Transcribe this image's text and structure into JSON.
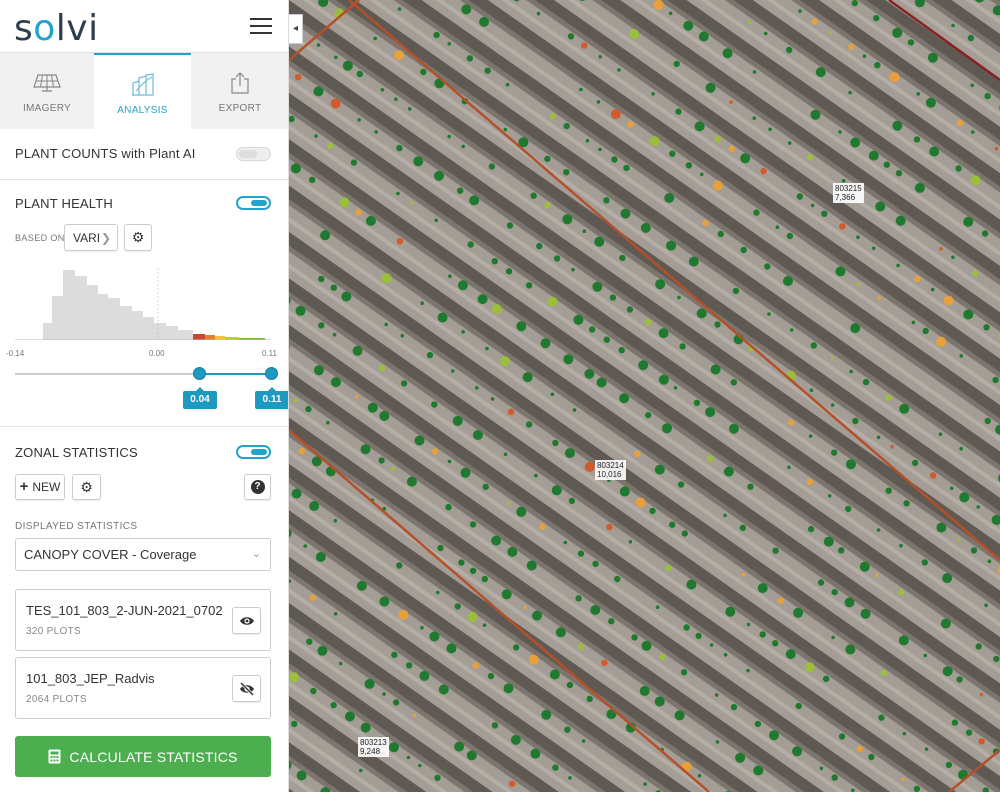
{
  "app": {
    "logo_text_s": "s",
    "logo_text_o": "o",
    "logo_text_rest": "lvi"
  },
  "tabs": [
    {
      "label": "IMAGERY",
      "icon": "solar-panel-icon",
      "active": false
    },
    {
      "label": "ANALYSIS",
      "icon": "analysis-chart-icon",
      "active": true
    },
    {
      "label": "EXPORT",
      "icon": "export-icon",
      "active": false
    }
  ],
  "plant_counts": {
    "title": "PLANT COUNTS with Plant AI",
    "enabled": false
  },
  "plant_health": {
    "title": "PLANT HEALTH",
    "enabled": true,
    "based_on_label": "BASED ON",
    "based_on_value": "VARI",
    "axis_ticks": [
      "-0.14",
      "0.00",
      "0.11"
    ],
    "range_low": "0.04",
    "range_high": "0.11"
  },
  "zonal_statistics": {
    "title": "ZONAL STATISTICS",
    "enabled": true,
    "new_button": "NEW",
    "displayed_label": "DISPLAYED STATISTICS",
    "displayed_value": "CANOPY COVER - Coverage",
    "layers": [
      {
        "name": "TES_101_803_2-JUN-2021_0702",
        "count": "320 PLOTS",
        "visible": true
      },
      {
        "name": "101_803_JEP_Radvis",
        "count": "2064 PLOTS",
        "visible": false
      }
    ],
    "calculate_button": "CALCULATE STATISTICS"
  },
  "map": {
    "plots": [
      {
        "id": "803215",
        "value": "7,366"
      },
      {
        "id": "803214",
        "value": "10,016"
      },
      {
        "id": "803213",
        "value": "9,248"
      }
    ]
  },
  "colors": {
    "accent": "#23a3c9",
    "slider": "#1e9ac0",
    "calculate": "#4cae4f",
    "boundary": "#b5502a",
    "vegetation": "#1f7a2f"
  }
}
